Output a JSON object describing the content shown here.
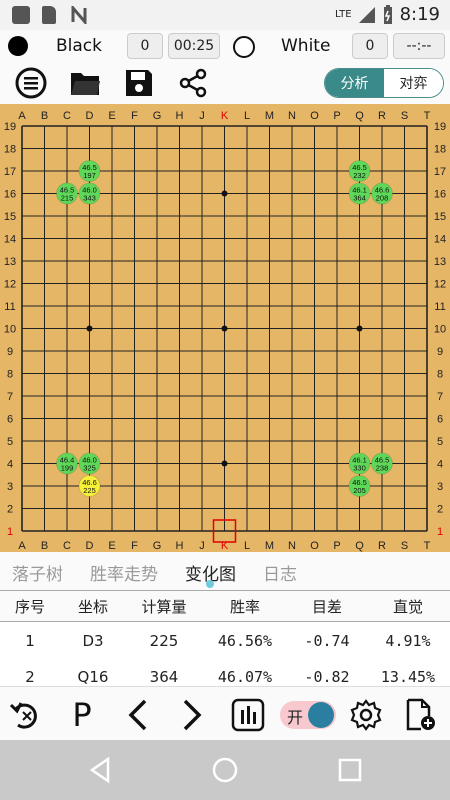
{
  "status": {
    "network": "LTE",
    "time": "8:19"
  },
  "players": {
    "black_name": "Black",
    "black_captures": "0",
    "black_time": "00:25",
    "white_name": "White",
    "white_captures": "0",
    "white_time": "--:--"
  },
  "toolbar": {
    "mode_analysis": "分析",
    "mode_play": "对弈"
  },
  "board": {
    "size": 19,
    "columns": [
      "A",
      "B",
      "C",
      "D",
      "E",
      "F",
      "G",
      "H",
      "J",
      "K",
      "L",
      "M",
      "N",
      "O",
      "P",
      "Q",
      "R",
      "S",
      "T"
    ],
    "rows": [
      "19",
      "18",
      "17",
      "16",
      "15",
      "14",
      "13",
      "12",
      "11",
      "10",
      "9",
      "8",
      "7",
      "6",
      "5",
      "4",
      "3",
      "2",
      "1"
    ],
    "highlight_column": "K",
    "highlight_row": "1",
    "hoshi": [
      "D16",
      "K16",
      "Q16",
      "D10",
      "K10",
      "Q10",
      "D4",
      "K4",
      "Q4"
    ],
    "last_move_marker": "K1",
    "candidates": [
      {
        "point": "D17",
        "winrate": "46.5",
        "visits": "197",
        "color": "green"
      },
      {
        "point": "C16",
        "winrate": "46.5",
        "visits": "215",
        "color": "green"
      },
      {
        "point": "D16",
        "winrate": "46.0",
        "visits": "343",
        "color": "green"
      },
      {
        "point": "Q17",
        "winrate": "46.5",
        "visits": "232",
        "color": "green"
      },
      {
        "point": "Q16",
        "winrate": "46.1",
        "visits": "364",
        "color": "green"
      },
      {
        "point": "R16",
        "winrate": "46.6",
        "visits": "208",
        "color": "green"
      },
      {
        "point": "C4",
        "winrate": "46.4",
        "visits": "199",
        "color": "green"
      },
      {
        "point": "D4",
        "winrate": "46.0",
        "visits": "325",
        "color": "green"
      },
      {
        "point": "D3",
        "winrate": "46.6",
        "visits": "225",
        "color": "yellow"
      },
      {
        "point": "Q4",
        "winrate": "46.1",
        "visits": "330",
        "color": "green"
      },
      {
        "point": "R4",
        "winrate": "46.5",
        "visits": "238",
        "color": "green"
      },
      {
        "point": "Q3",
        "winrate": "46.5",
        "visits": "205",
        "color": "green"
      }
    ]
  },
  "tabs": [
    {
      "label": "落子树",
      "active": false
    },
    {
      "label": "胜率走势",
      "active": false
    },
    {
      "label": "变化图",
      "active": true
    },
    {
      "label": "日志",
      "active": false
    }
  ],
  "table": {
    "headers": [
      "序号",
      "坐标",
      "计算量",
      "胜率",
      "目差",
      "直觉"
    ],
    "rows": [
      [
        "1",
        "D3",
        "225",
        "46.56%",
        "-0.74",
        "4.91%"
      ],
      [
        "2",
        "Q16",
        "364",
        "46.07%",
        "-0.82",
        "13.45%"
      ]
    ]
  },
  "bottom": {
    "toggle_label": "开",
    "pass_label": "P"
  },
  "colors": {
    "board": "#e6b667",
    "candidate_green": "#5fd85a",
    "candidate_yellow": "#f5f03a",
    "accent": "#3a8a8a",
    "highlight": "#e00000"
  }
}
